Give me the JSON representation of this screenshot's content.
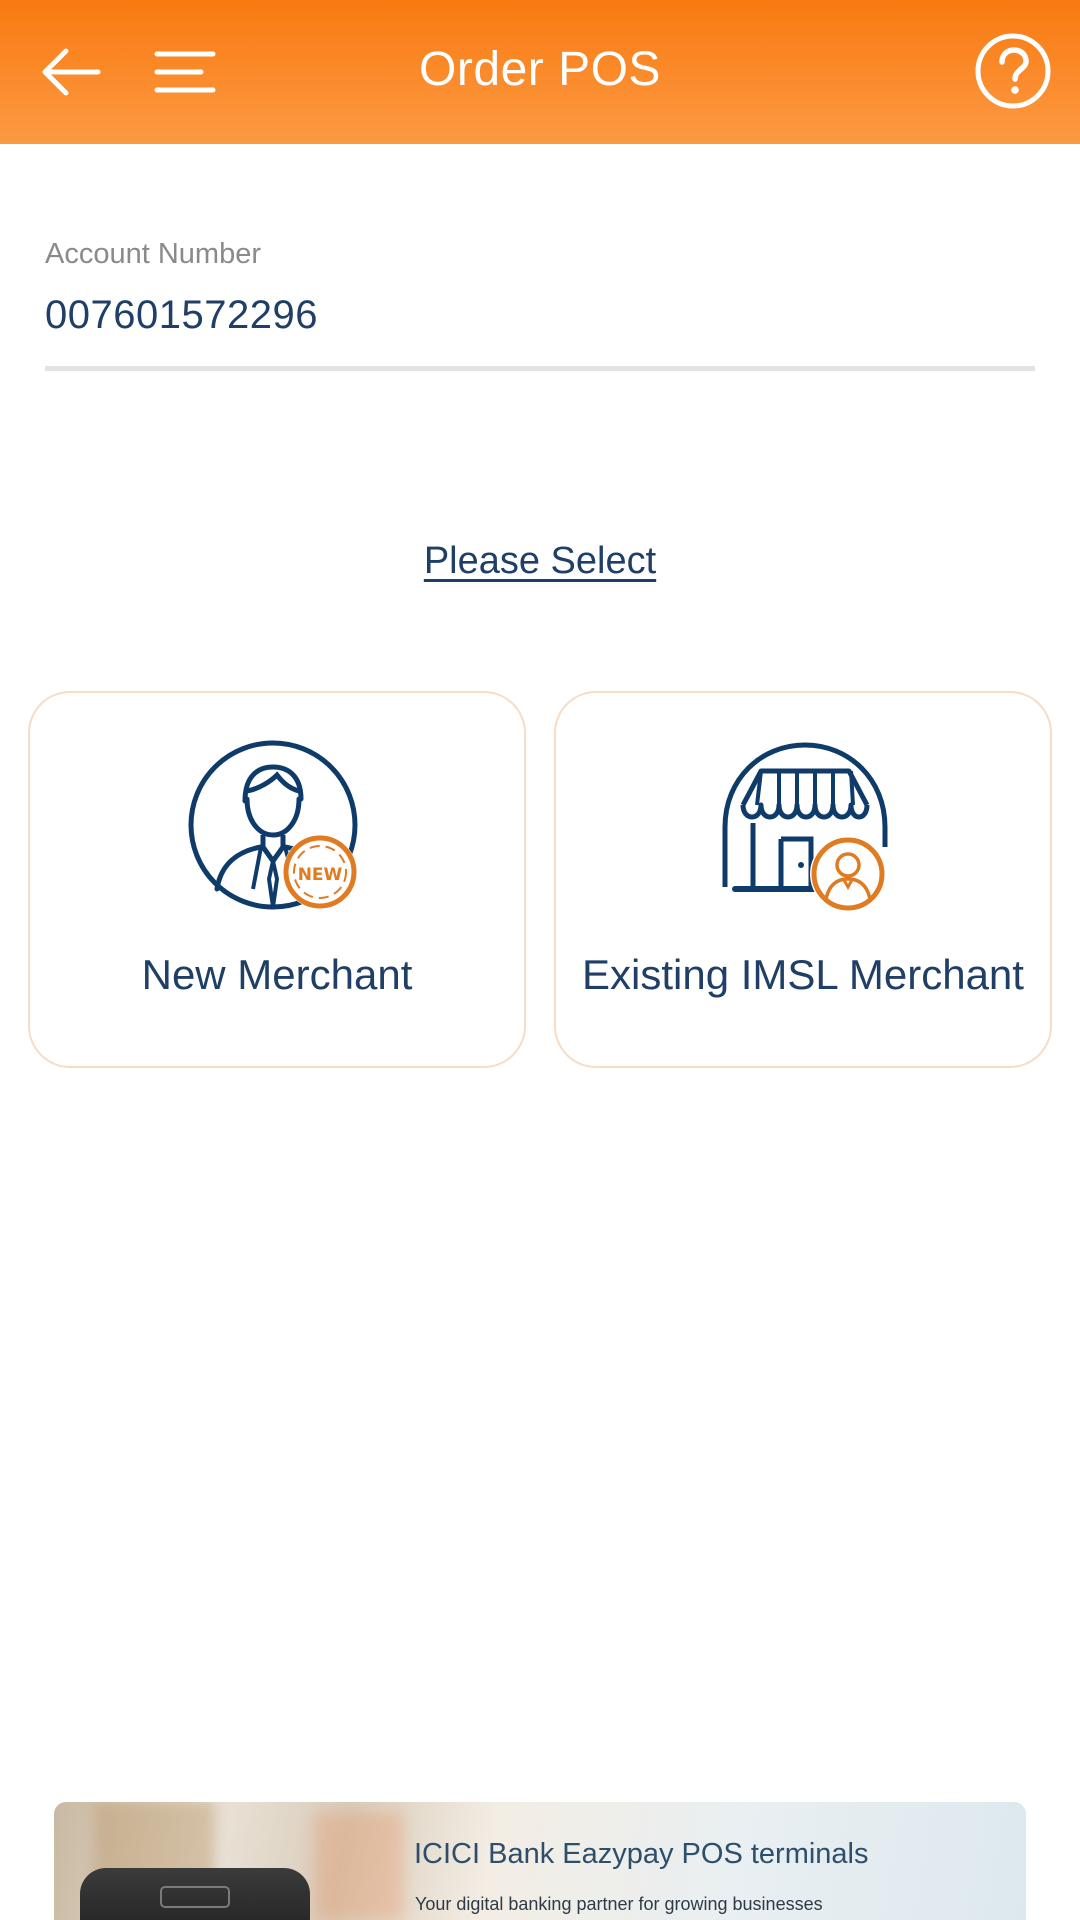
{
  "header": {
    "title": "Order POS",
    "back_icon": "arrow-left-icon",
    "menu_icon": "hamburger-icon",
    "help_icon": "question-circle-icon"
  },
  "account": {
    "label": "Account Number",
    "value": "007601572296"
  },
  "prompt": "Please Select",
  "options": [
    {
      "label": "New Merchant",
      "icon": "new-merchant-icon",
      "badge": "NEW"
    },
    {
      "label": "Existing IMSL Merchant",
      "icon": "existing-merchant-store-icon"
    }
  ],
  "banner": {
    "title": "ICICI Bank Eazypay POS terminals",
    "subtitle": "Your digital banking partner for growing businesses"
  },
  "colors": {
    "header_orange": "#f87a10",
    "text_navy": "#1f3f66",
    "icon_navy": "#0f3b6b",
    "accent_orange": "#e07b22",
    "card_border": "#f7dcc6"
  }
}
